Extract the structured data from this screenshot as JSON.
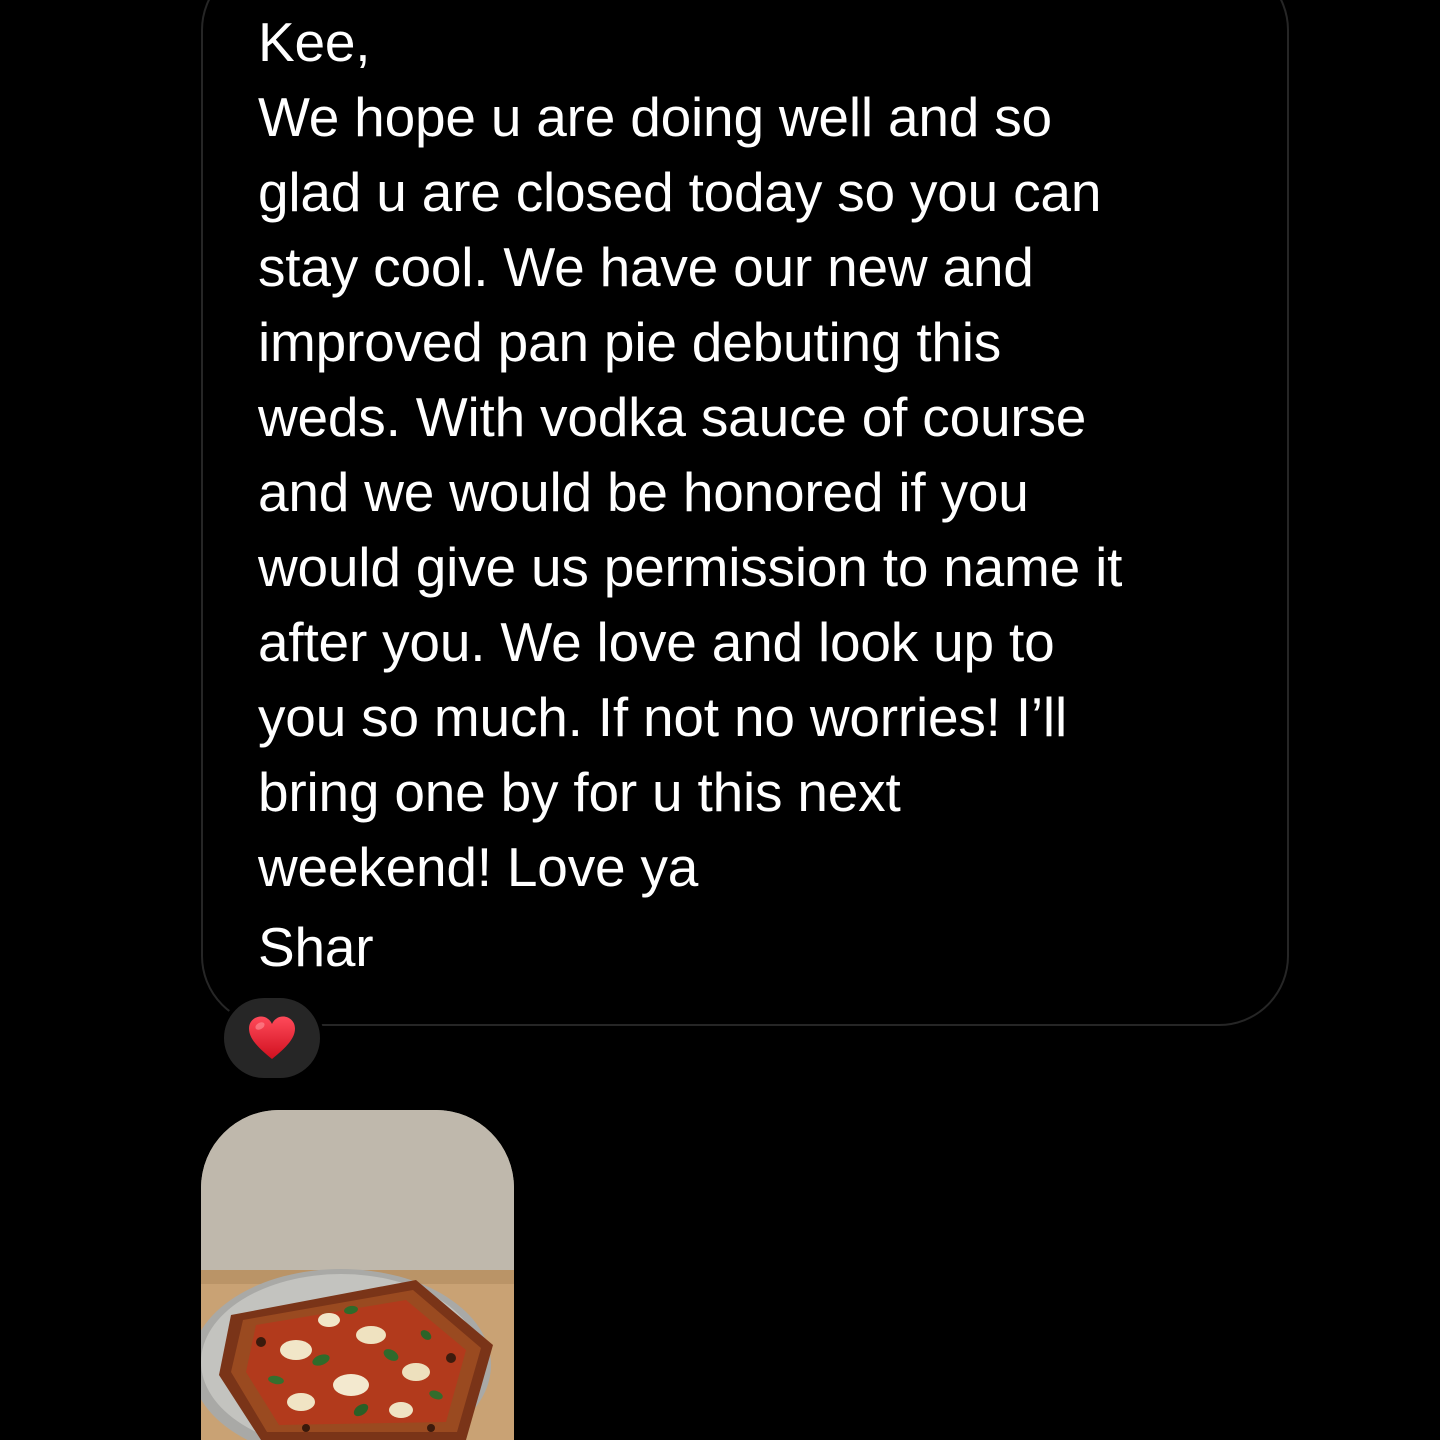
{
  "message": {
    "greeting": "Kee,",
    "lines": [
      "We hope u are doing well and so",
      "glad u are closed today so you can",
      "stay cool. We have our new and",
      "improved pan pie debuting this",
      "weds. With vodka sauce of course",
      "and we would be honored if you",
      "would give us permission to name it",
      "after you. We love and look up to",
      "you so much. If not no worries! I’ll",
      "bring one by for u this next",
      "weekend! Love ya"
    ],
    "signature": "Shar"
  },
  "reaction": {
    "icon": "heart-icon",
    "color": "#e0162b"
  },
  "attachment": {
    "type": "photo",
    "subject": "pan pizza on a metal tray",
    "background_color": "#bfb8ac"
  },
  "colors": {
    "background": "#000000",
    "bubble_border": "#262626",
    "text": "#ffffff",
    "reaction_bg": "#262626"
  }
}
